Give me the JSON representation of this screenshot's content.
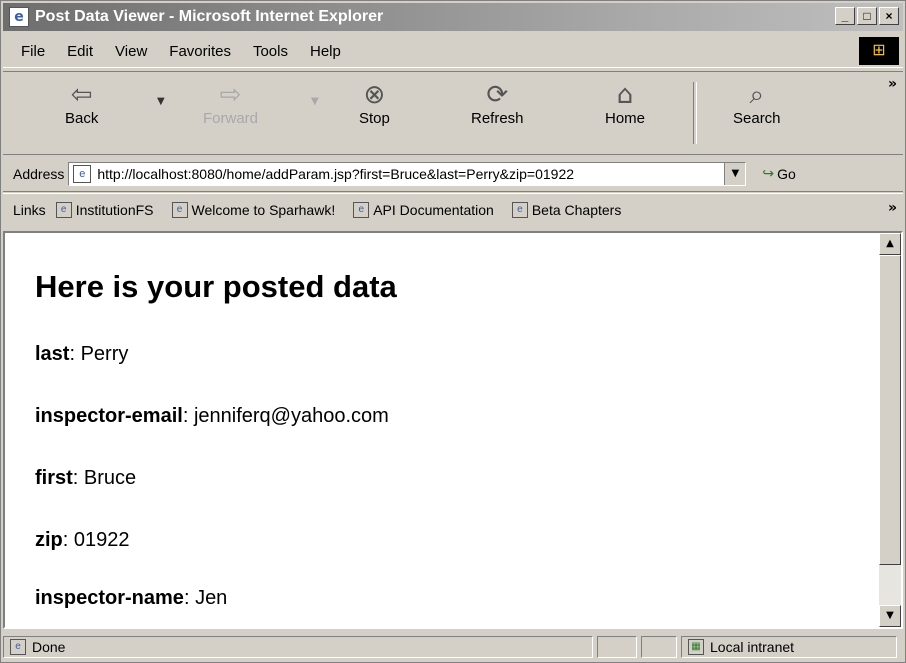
{
  "window": {
    "title": "Post Data Viewer - Microsoft Internet Explorer",
    "controls": [
      "_",
      "□",
      "×"
    ]
  },
  "menu": [
    "File",
    "Edit",
    "View",
    "Favorites",
    "Tools",
    "Help"
  ],
  "toolbar": {
    "back": "Back",
    "forward": "Forward",
    "stop": "Stop",
    "refresh": "Refresh",
    "home": "Home",
    "search": "Search"
  },
  "address": {
    "label": "Address",
    "url": "http://localhost:8080/home/addParam.jsp?first=Bruce&last=Perry&zip=01922",
    "go": "Go"
  },
  "links": {
    "label": "Links",
    "items": [
      "InstitutionFS",
      "Welcome to Sparhawk!",
      "API Documentation",
      "Beta Chapters"
    ]
  },
  "page": {
    "heading": "Here is your posted data",
    "fields": [
      {
        "name": "last",
        "value": "Perry"
      },
      {
        "name": "inspector-email",
        "value": "jenniferq@yahoo.com"
      },
      {
        "name": "first",
        "value": "Bruce"
      },
      {
        "name": "zip",
        "value": "01922"
      },
      {
        "name": "inspector-name",
        "value": "Jen"
      }
    ]
  },
  "status": {
    "text": "Done",
    "zone": "Local intranet"
  },
  "icons": {
    "page": "ie-page-icon",
    "back": "back-arrow-icon",
    "forward": "forward-arrow-icon",
    "stop": "stop-icon",
    "refresh": "refresh-icon",
    "home": "home-icon",
    "search": "search-icon"
  }
}
